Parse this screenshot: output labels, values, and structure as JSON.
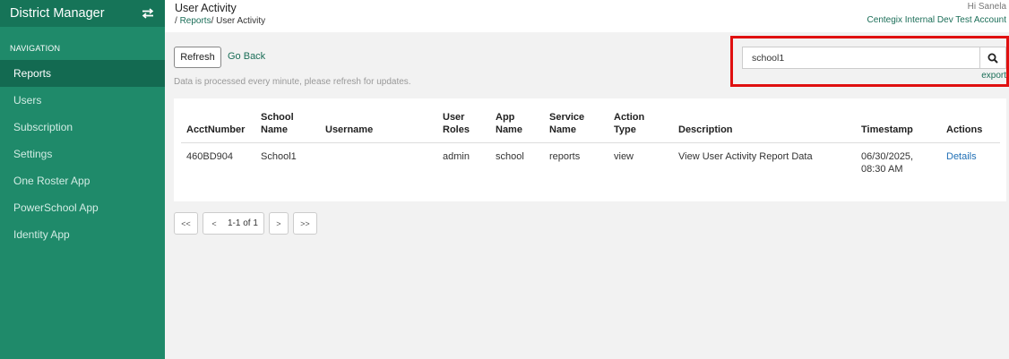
{
  "sidebar": {
    "title": "District Manager",
    "swap_icon": "swap-arrows-icon",
    "nav_label": "NAVIGATION",
    "items": [
      {
        "label": "Reports",
        "active": true
      },
      {
        "label": "Users"
      },
      {
        "label": "Subscription"
      },
      {
        "label": "Settings"
      },
      {
        "label": "One Roster App"
      },
      {
        "label": "PowerSchool App"
      },
      {
        "label": "Identity App"
      }
    ]
  },
  "header": {
    "title": "User Activity",
    "breadcrumb_prefix": "/ ",
    "breadcrumb_link": "Reports",
    "breadcrumb_sep": "/ ",
    "breadcrumb_current": "User Activity",
    "greeting": "Hi Sanela",
    "account": "Centegix Internal Dev Test Account"
  },
  "toolbar": {
    "refresh_label": "Refresh",
    "go_back_label": "Go Back",
    "notice": "Data is processed every minute, please refresh for updates."
  },
  "search": {
    "value": "school1",
    "icon": "search-icon",
    "export_label": "export"
  },
  "table": {
    "headers": [
      "AcctNumber",
      "School Name",
      "Username",
      "User Roles",
      "App Name",
      "Service Name",
      "Action Type",
      "Description",
      "Timestamp",
      "Actions"
    ],
    "rows": [
      {
        "acct": "460BD904",
        "school": "School1",
        "username": "",
        "roles": "admin",
        "app": "school",
        "service": "reports",
        "action_type": "view",
        "description": "View User Activity Report Data",
        "timestamp_date": "06/30/2025,",
        "timestamp_time": "08:30 AM",
        "action_link": "Details"
      }
    ]
  },
  "pagination": {
    "first": "<<",
    "prev": "<",
    "info": "1-1 of 1",
    "next": ">",
    "last": ">>"
  },
  "colors": {
    "sidebar_bg": "#1f8a6a",
    "sidebar_active": "#136a51",
    "link_green": "#1b6e58",
    "highlight_red": "#e01010",
    "details_blue": "#1f6fb5"
  }
}
